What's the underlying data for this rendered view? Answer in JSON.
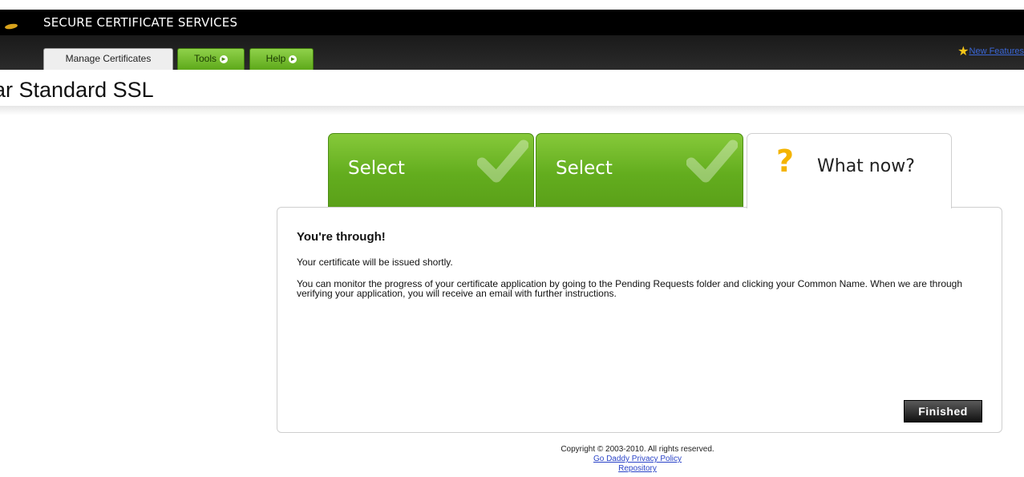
{
  "header": {
    "app_title": "SECURE CERTIFICATE SERVICES",
    "new_features_label": "New Features"
  },
  "nav": {
    "tabs": [
      {
        "label": "Manage Certificates"
      },
      {
        "label": "Tools"
      },
      {
        "label": "Help"
      }
    ]
  },
  "page": {
    "title": "ar Standard SSL"
  },
  "wizard": {
    "steps": [
      {
        "label": "Select",
        "state": "complete"
      },
      {
        "label": "Select",
        "state": "complete"
      },
      {
        "label": "What now?",
        "state": "current"
      }
    ]
  },
  "content": {
    "heading": "You're through!",
    "paragraph1": "Your certificate will be issued shortly.",
    "paragraph2": "You can monitor the progress of your certificate application by going to the Pending Requests folder and clicking your Common Name. When we are through verifying your application, you will receive an email with further instructions.",
    "finished_label": "Finished"
  },
  "footer": {
    "copyright": "Copyright © 2003-2010. All rights reserved.",
    "privacy_link": "Go Daddy Privacy Policy",
    "repository_link": "Repository"
  },
  "colors": {
    "accent_green": "#63ad1e",
    "header_bg": "#000000",
    "link_blue": "#2a43c8",
    "question_yellow": "#f4b400"
  }
}
